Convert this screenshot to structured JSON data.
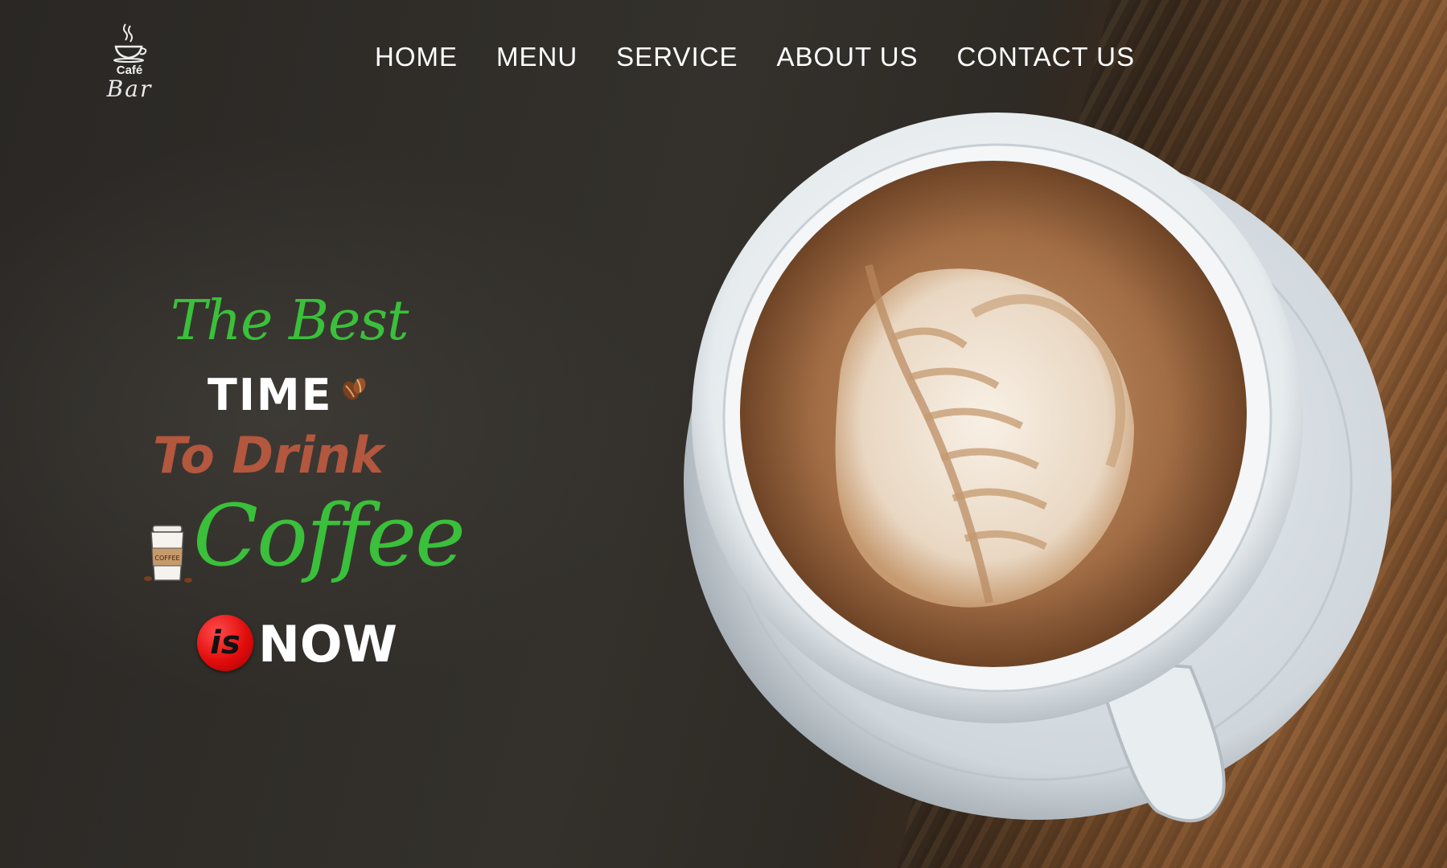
{
  "logo": {
    "cafe": "Café",
    "bar": "Bar"
  },
  "nav": {
    "items": [
      {
        "label": "HOME"
      },
      {
        "label": "MENU"
      },
      {
        "label": "SERVICE"
      },
      {
        "label": "ABOUT US"
      },
      {
        "label": "CONTACT US"
      }
    ]
  },
  "hero": {
    "line1": "The Best",
    "line2": "TIME",
    "line3": "To Drink",
    "line4": "Coffee",
    "badge": "is",
    "line5": "NOW",
    "cup_label": "COFFEE"
  },
  "colors": {
    "green": "#3ac03a",
    "rust": "#b3573e",
    "red": "#e20d0d",
    "white": "#ffffff"
  }
}
